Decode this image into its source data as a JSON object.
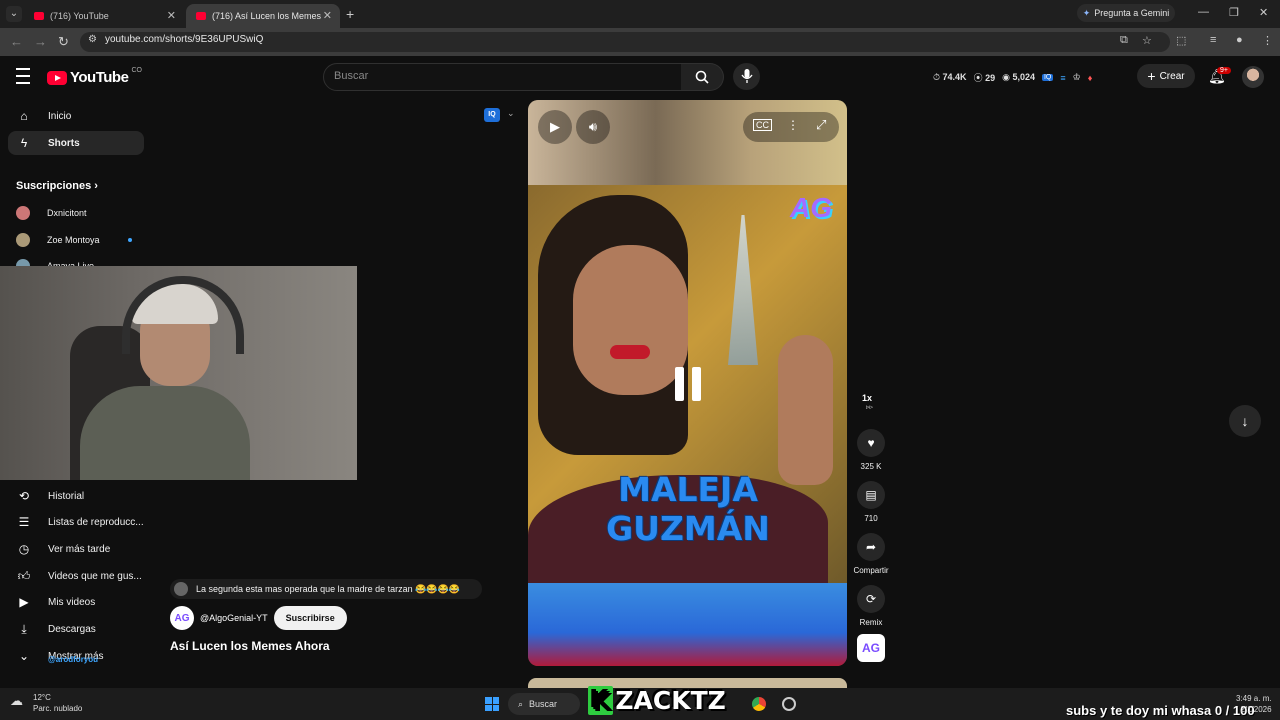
{
  "browser": {
    "tabs": [
      {
        "label": "(716) YouTube"
      },
      {
        "label": "(716) Así Lucen los Memes"
      }
    ],
    "gemini_label": "Pregunta a Gemini",
    "url": "youtube.com/shorts/9E36UPUSwiQ"
  },
  "header": {
    "logo_text": "YouTube",
    "country_code": "CO",
    "search_placeholder": "Buscar",
    "stats": {
      "views": "74.4K",
      "likes": "29",
      "watching": "5,024"
    },
    "create_label": "Crear",
    "notif_badge": "9+"
  },
  "sidebar": {
    "top": [
      {
        "label": "Inicio",
        "icon": "home-icon"
      },
      {
        "label": "Shorts",
        "icon": "shorts-icon"
      }
    ],
    "subs_heading": "Suscripciones",
    "subscriptions": [
      {
        "label": "Dxnicitont"
      },
      {
        "label": "Zoe Montoya"
      },
      {
        "label": "Amaya Live"
      }
    ],
    "library": [
      {
        "label": "Historial",
        "icon": "history-icon"
      },
      {
        "label": "Listas de reproducc...",
        "icon": "playlist-icon"
      },
      {
        "label": "Ver más tarde",
        "icon": "clock-icon"
      },
      {
        "label": "Videos que me gus...",
        "icon": "like-icon"
      },
      {
        "label": "Mis videos",
        "icon": "video-icon"
      },
      {
        "label": "Descargas",
        "icon": "download-icon"
      },
      {
        "label": "Mostrar más",
        "icon": "chevron-down-icon"
      }
    ],
    "overlay_username": "@arodforyou"
  },
  "video": {
    "caption_line1": "MALEJA",
    "caption_line2": "GUZMÁN",
    "logo_text": "AG",
    "speed": "1x",
    "likes": "325 K",
    "comments": "710",
    "share_label": "Compartir",
    "remix_label": "Remix",
    "comment_preview": "La segunda esta mas operada que la madre de tarzan 😂😂😂😂",
    "channel": "@AlgoGenial-YT",
    "subscribe_label": "Suscribirse",
    "title": "Así Lucen los Memes Ahora"
  },
  "taskbar": {
    "temp": "12°C",
    "weather": "Parc. nublado",
    "search_label": "Buscar",
    "streamer_tag": "ZACKTZ",
    "overlay_text": "subs y te doy mi whasa 0 / 100",
    "time": "3:49 a. m.",
    "date": "2/1/2026"
  },
  "colors": {
    "accent": "#ff0033",
    "background": "#0f0f0f",
    "caption_blue": "#2a8af0"
  }
}
